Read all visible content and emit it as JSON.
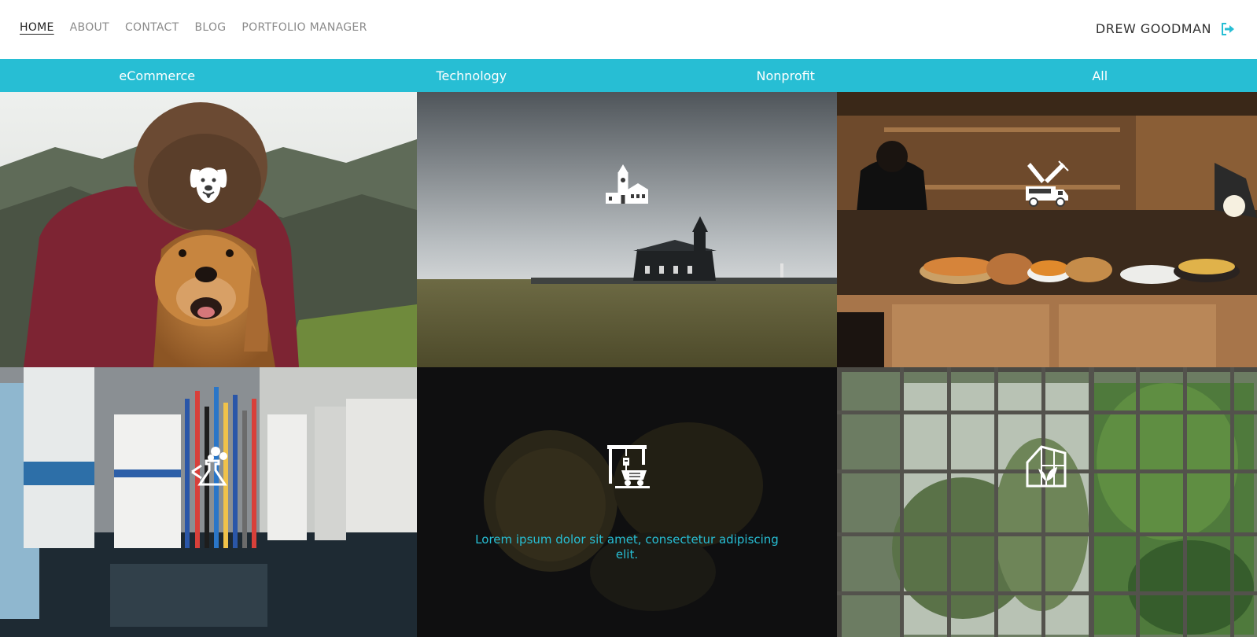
{
  "nav": {
    "links": [
      {
        "label": "HOME",
        "active": true
      },
      {
        "label": "ABOUT",
        "active": false
      },
      {
        "label": "CONTACT",
        "active": false
      },
      {
        "label": "BLOG",
        "active": false
      },
      {
        "label": "PORTFOLIO MANAGER",
        "active": false
      }
    ],
    "user_name": "DREW GOODMAN",
    "logout_icon": "sign-out-icon",
    "accent_color": "#27bed4"
  },
  "filters": [
    "eCommerce",
    "Technology",
    "Nonprofit",
    "All"
  ],
  "portfolio": {
    "items": [
      {
        "icon": "dog-icon",
        "image": "man-hugging-dog-photo"
      },
      {
        "icon": "church-icon",
        "image": "black-church-field-photo"
      },
      {
        "icon": "food-truck-icon",
        "image": "food-counter-photo"
      },
      {
        "icon": "lab-flask-icon",
        "image": "lab-pens-photo"
      },
      {
        "icon": "mining-cart-icon",
        "image": "gold-jewelry-photo",
        "description": "Lorem ipsum dolor sit amet, consectetur adipiscing elit."
      },
      {
        "icon": "greenhouse-icon",
        "image": "greenhouse-window-photo"
      }
    ]
  }
}
